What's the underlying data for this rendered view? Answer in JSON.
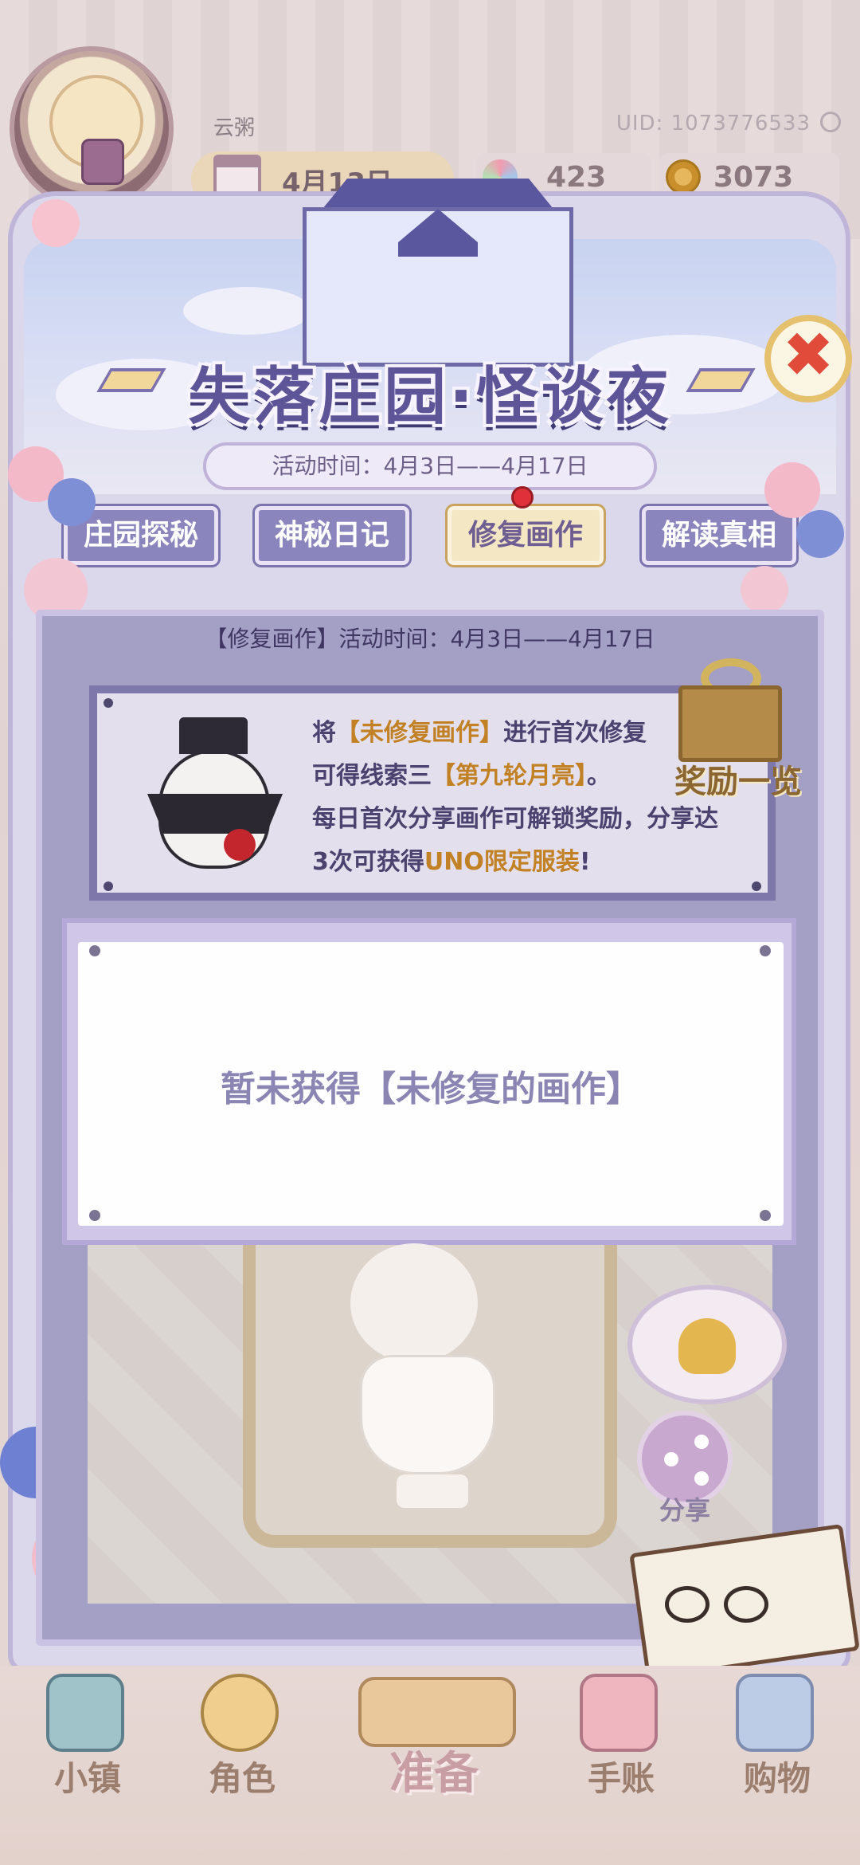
{
  "player": {
    "name": "云粥",
    "uid_label": "UID: 1073776533"
  },
  "header": {
    "date": "4月13日",
    "gems": "423",
    "coins": "3073"
  },
  "event": {
    "title": "失落庄园·怪谈夜",
    "period": "活动时间：4月3日——4月17日",
    "tabs": [
      {
        "label": "庄园探秘",
        "active": false
      },
      {
        "label": "神秘日记",
        "active": false
      },
      {
        "label": "修复画作",
        "active": true
      },
      {
        "label": "解读真相",
        "active": false
      }
    ],
    "close_symbol": "✖"
  },
  "repair": {
    "heading": "【修复画作】活动时间：4月3日——4月17日",
    "line1_pre": "将",
    "line1_hl": "【未修复画作】",
    "line1_post": "进行首次修复",
    "line2_pre": "可得线索三",
    "line2_hl": "【第九轮月亮】",
    "line2_post": "。",
    "line3": "每日首次分享画作可解锁奖励，分享达",
    "line4_pre": "3次可获得",
    "line4_hl": "UNO限定服装",
    "line4_post": "!",
    "reward_label": "奖励一览",
    "empty_message": "暂未获得【未修复的画作】",
    "share_label": "分享"
  },
  "nav": {
    "items": [
      {
        "label": "小镇",
        "icon": "map-icon"
      },
      {
        "label": "角色",
        "icon": "character-icon"
      },
      {
        "label": "准备",
        "icon": "prepare-icon",
        "active": true
      },
      {
        "label": "手账",
        "icon": "journal-icon"
      },
      {
        "label": "购物",
        "icon": "shopping-bag-icon"
      }
    ]
  },
  "colors": {
    "accent_purple": "#5e5598",
    "highlight_orange": "#c28124",
    "close_red": "#e04b3a"
  }
}
